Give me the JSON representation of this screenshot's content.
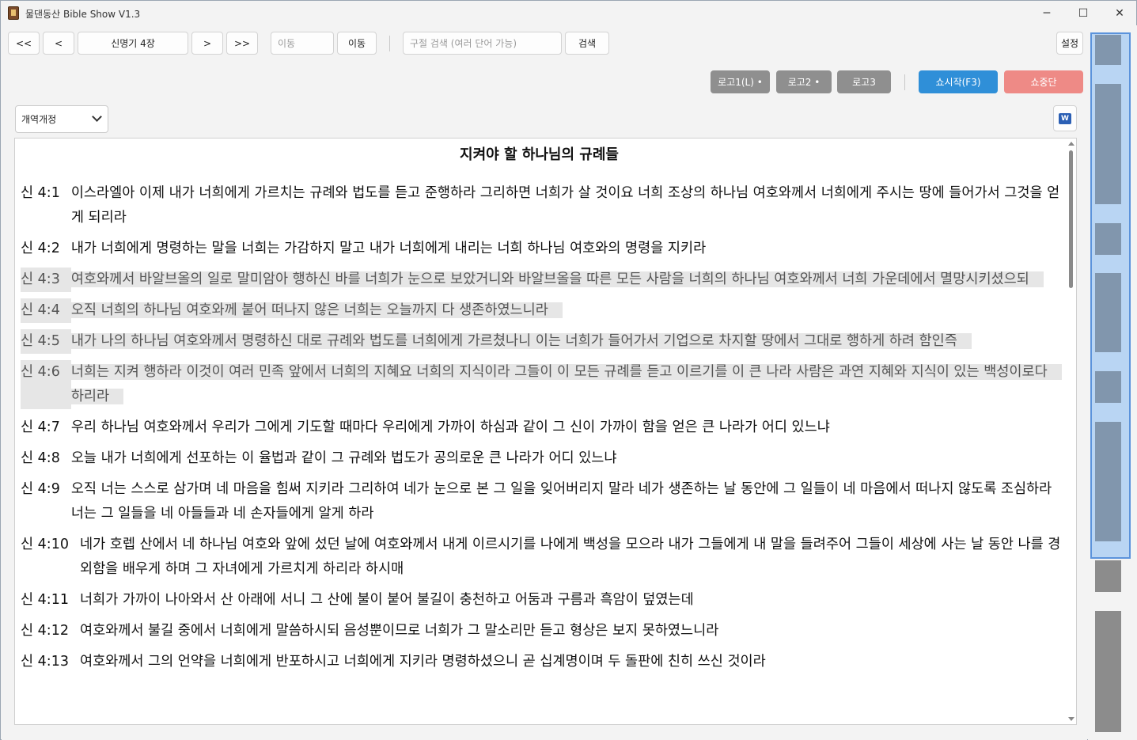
{
  "window": {
    "title": "물댄동산 Bible Show V1.3",
    "controls": {
      "minimize": "─",
      "maximize": "☐",
      "close": "✕"
    }
  },
  "toolbar": {
    "first": "<<",
    "prev": "<",
    "chapter": "신명기 4장",
    "next": ">",
    "last": ">>",
    "goto_placeholder": "이동",
    "goto_button": "이동",
    "search_placeholder": "구절 검색 (여러 단어 가능)",
    "search_button": "검색",
    "settings_button": "설정"
  },
  "show_controls": {
    "logo1": "로고1(L) •",
    "logo2": "로고2 •",
    "logo3": "로고3",
    "start": "쇼시작(F3)",
    "stop": "쇼중단",
    "start_color": "#2f8fd8",
    "stop_color": "#ee8a86"
  },
  "version_select": {
    "selected": "개역개정"
  },
  "word_export": {
    "icon": "word-icon",
    "label": "W"
  },
  "content": {
    "title": "지켜야 할 하나님의 규례들",
    "verses": [
      {
        "ref": "신 4:1",
        "text": "이스라엘아 이제 내가 너희에게 가르치는 규례와 법도를 듣고 준행하라 그리하면 너희가 살 것이요 너희 조상의 하나님 여호와께서 너희에게 주시는 땅에 들어가서 그것을 얻게 되리라",
        "highlight": false
      },
      {
        "ref": "신 4:2",
        "text": "내가 너희에게 명령하는 말을 너희는 가감하지 말고 내가 너희에게 내리는 너희 하나님 여호와의 명령을 지키라",
        "highlight": false
      },
      {
        "ref": "신 4:3",
        "text": "여호와께서 바알브올의 일로 말미암아 행하신 바를 너희가 눈으로 보았거니와 바알브올을 따른 모든 사람을 너희의 하나님 여호와께서 너희 가운데에서 멸망시키셨으되",
        "highlight": true
      },
      {
        "ref": "신 4:4",
        "text": "오직 너희의 하나님 여호와께 붙어 떠나지 않은 너희는 오늘까지 다 생존하였느니라",
        "highlight": true
      },
      {
        "ref": "신 4:5",
        "text": "내가 나의 하나님 여호와께서 명령하신 대로 규례와 법도를 너희에게 가르쳤나니 이는 너희가 들어가서 기업으로 차지할 땅에서 그대로 행하게 하려 함인즉",
        "highlight": true
      },
      {
        "ref": "신 4:6",
        "text": "너희는 지켜 행하라 이것이 여러 민족 앞에서 너희의 지혜요 너희의 지식이라 그들이 이 모든 규례를 듣고 이르기를 이 큰 나라 사람은 과연 지혜와 지식이 있는 백성이로다 하리라",
        "highlight": true
      },
      {
        "ref": "신 4:7",
        "text": "우리 하나님 여호와께서 우리가 그에게 기도할 때마다 우리에게 가까이 하심과 같이 그 신이 가까이 함을 얻은 큰 나라가 어디 있느냐",
        "highlight": false
      },
      {
        "ref": "신 4:8",
        "text": "오늘 내가 너희에게 선포하는 이 율법과 같이 그 규례와 법도가 공의로운 큰 나라가 어디 있느냐",
        "highlight": false
      },
      {
        "ref": "신 4:9",
        "text": "오직 너는 스스로 삼가며 네 마음을 힘써 지키라 그리하여 네가 눈으로 본 그 일을 잊어버리지 말라 네가 생존하는 날 동안에 그 일들이 네 마음에서 떠나지 않도록 조심하라 너는 그 일들을 네 아들들과 네 손자들에게 알게 하라",
        "highlight": false
      },
      {
        "ref": "신 4:10",
        "text": "네가 호렙 산에서 네 하나님 여호와 앞에 섰던 날에 여호와께서 내게 이르시기를 나에게 백성을 모으라 내가 그들에게 내 말을 들려주어 그들이 세상에 사는 날 동안 나를 경외함을 배우게 하며 그 자녀에게 가르치게 하리라 하시매",
        "highlight": false
      },
      {
        "ref": "신 4:11",
        "text": "너희가 가까이 나아와서 산 아래에 서니 그 산에 불이 붙어 불길이 충천하고 어둠과 구름과 흑암이 덮였는데",
        "highlight": false
      },
      {
        "ref": "신 4:12",
        "text": "여호와께서 불길 중에서 너희에게 말씀하시되 음성뿐이므로 너희가 그 말소리만 듣고 형상은 보지 못하였느니라",
        "highlight": false
      },
      {
        "ref": "신 4:13",
        "text": "여호와께서 그의 언약을 너희에게 반포하시고 너희에게 지키라 명령하셨으니 곧 십계명이며 두 돌판에 친히 쓰신 것이라",
        "highlight": false
      }
    ]
  }
}
